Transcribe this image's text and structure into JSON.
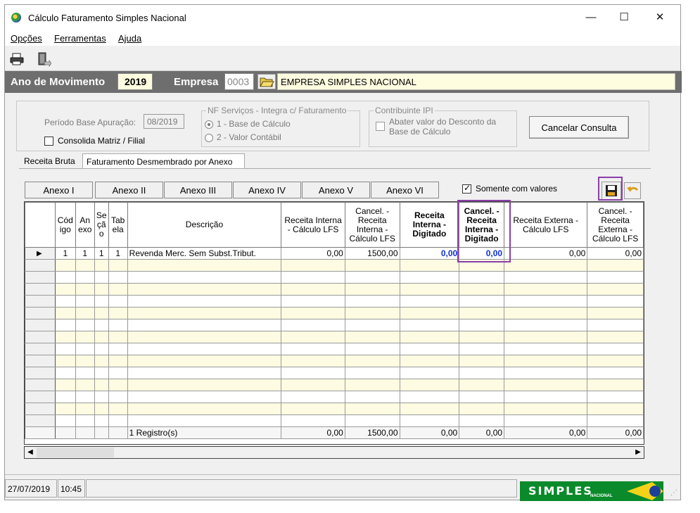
{
  "window": {
    "title": "Cálculo Faturamento Simples Nacional",
    "controls": [
      "—",
      "☐",
      "✕"
    ]
  },
  "menu": [
    "Opções",
    "Ferramentas",
    "Ajuda"
  ],
  "toolbar": {
    "icons": [
      "printer-icon",
      "exit-door-icon"
    ]
  },
  "header": {
    "ano_label": "Ano de Movimento",
    "ano_value": "2019",
    "empresa_label": "Empresa",
    "empresa_code": "0003",
    "empresa_name": "EMPRESA SIMPLES NACIONAL"
  },
  "options": {
    "periodo_label": "Período Base Apuração:",
    "periodo_value": "08/2019",
    "consolida_label": "Consolida Matriz / Filial",
    "consolida_checked": false,
    "nf_group_title": "NF Serviços - Integra c/ Faturamento",
    "nf_option1": "1 - Base de Cálculo",
    "nf_option2": "2 - Valor Contábil",
    "ipi_group_title": "Contribuinte IPI",
    "ipi_abater_label": "Abater valor do Desconto da Base de Cálculo",
    "cancelar_label": "Cancelar Consulta"
  },
  "tabs": [
    "Receita Bruta",
    "Faturamento Desmembrado por Anexo"
  ],
  "anexos": [
    "Anexo I",
    "Anexo II",
    "Anexo III",
    "Anexo IV",
    "Anexo V",
    "Anexo VI"
  ],
  "somente_label": "Somente com valores",
  "somente_checked": true,
  "grid": {
    "columns": [
      "",
      "Cód igo",
      "An exo",
      "Se çã o",
      "Tab ela",
      "Descrição",
      "Receita Interna - Cálculo LFS",
      "Cancel. - Receita Interna - Cálculo LFS",
      "Receita Interna - Digitado",
      "Cancel. - Receita Interna - Digitado",
      "Receita Externa - Cálculo LFS",
      "Cancel. - Receita Externa - Cálculo LFS"
    ],
    "row1": {
      "codigo": "1",
      "anexo": "1",
      "secao": "1",
      "tabela": "1",
      "descricao": "Revenda Merc. Sem Subst.Tribut.",
      "receita_interna_lfs": "0,00",
      "cancel_receita_interna_lfs": "1500,00",
      "receita_interna_digitado": "0,00",
      "cancel_receita_interna_digitado": "0,00",
      "receita_externa_lfs": "0,00",
      "cancel_receita_externa_lfs": "0,00"
    },
    "totals": {
      "registros": "1 Registro(s)",
      "receita_interna_lfs": "0,00",
      "cancel_receita_interna_lfs": "1500,00",
      "receita_interna_digitado": "0,00",
      "cancel_receita_interna_digitado": "0,00",
      "receita_externa_lfs": "0,00",
      "cancel_receita_externa_lfs": "0,00"
    }
  },
  "status": {
    "date": "27/07/2019",
    "time": "10:45"
  },
  "logo_text": "SIMPLES",
  "logo_subtext": "NACIONAL",
  "colors": {
    "highlight": "#8c3fa8",
    "band": "#6e6e6e",
    "editable_value": "#1030d0",
    "alt_row": "#fdfbe2"
  }
}
